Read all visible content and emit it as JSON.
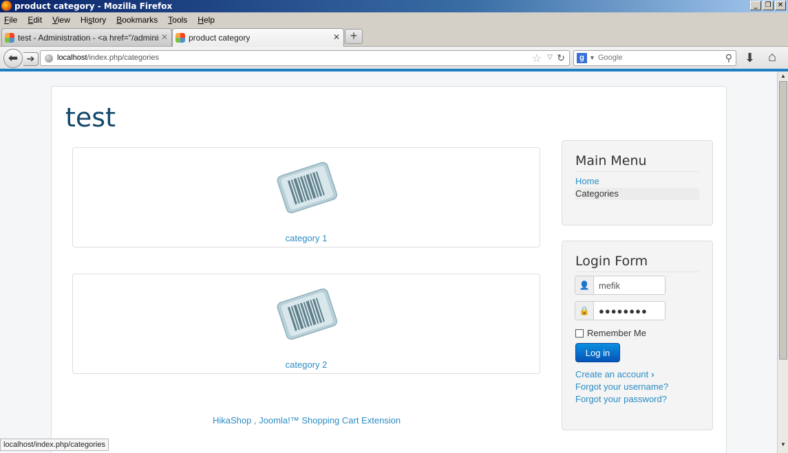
{
  "window": {
    "title": "product category - Mozilla Firefox"
  },
  "menubar": {
    "items": [
      {
        "pre": "",
        "u": "F",
        "post": "ile"
      },
      {
        "pre": "",
        "u": "E",
        "post": "dit"
      },
      {
        "pre": "",
        "u": "V",
        "post": "iew"
      },
      {
        "pre": "Hi",
        "u": "s",
        "post": "tory"
      },
      {
        "pre": "",
        "u": "B",
        "post": "ookmarks"
      },
      {
        "pre": "",
        "u": "T",
        "post": "ools"
      },
      {
        "pre": "",
        "u": "H",
        "post": "elp"
      }
    ]
  },
  "tabs": [
    {
      "label": "test - Administration - <a href=\"/adminis...",
      "active": false
    },
    {
      "label": "product category",
      "active": true
    }
  ],
  "navbar": {
    "url_host": "localhost",
    "url_path": "/index.php/categories",
    "search_placeholder": "Google"
  },
  "page": {
    "site_title": "test",
    "categories": [
      {
        "name": "category 1"
      },
      {
        "name": "category 2"
      }
    ],
    "footer_link": "HikaShop , Joomla!™ Shopping Cart Extension"
  },
  "main_menu": {
    "title": "Main Menu",
    "items": [
      "Home",
      "Categories"
    ]
  },
  "login": {
    "title": "Login Form",
    "username": "mefik",
    "password": "●●●●●●●●",
    "remember_label": "Remember Me",
    "button_label": "Log in",
    "create_account": "Create an account",
    "forgot_username": "Forgot your username?",
    "forgot_password": "Forgot your password?"
  },
  "statusbar": {
    "text": "localhost/index.php/categories"
  },
  "colors": {
    "link": "#2a8cc4",
    "title": "#13486a",
    "accent_line": "#1f7ec2",
    "button": "#0553b8"
  }
}
